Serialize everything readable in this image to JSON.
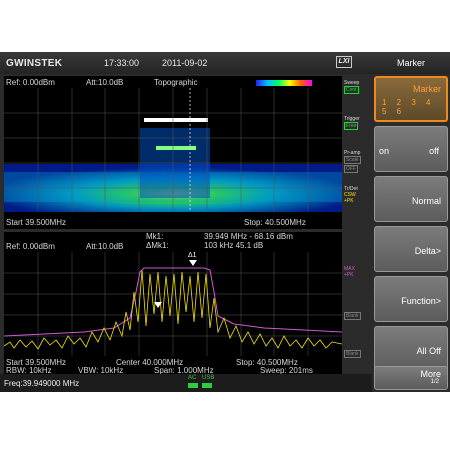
{
  "header": {
    "brand": "GWINSTEK",
    "time": "17:33:00",
    "date": "2011-09-02",
    "lxi": "LXI",
    "menu_title": "Marker"
  },
  "waterfall": {
    "ref": "Ref: 0.00dBm",
    "att": "Att:10.0dB",
    "mode": "Topographic",
    "start": "Start 39.500MHz",
    "stop": "Stop: 40.500MHz"
  },
  "spectrum": {
    "ref": "Ref: 0.00dBm",
    "att": "Att:10.0dB",
    "mk1_label": "Mk1:",
    "mk1_value": "39.949 MHz  - 68.16 dBm",
    "dmk1_label": "ΔMk1:",
    "dmk1_value": "103 kHz  45.1    dB",
    "start": "Start 39.500MHz",
    "center": "Center 40.000MHz",
    "stop": "Stop: 40.500MHz",
    "rbw": "RBW: 10kHz",
    "vbw": "VBW: 10kHz",
    "span": "Span: 1.000MHz",
    "sweep": "Sweep: 201ms",
    "marker_label": "Δ1"
  },
  "status": {
    "sweep_label": "Sweep",
    "sweep_value": "Cont",
    "trigger_label": "Trigger",
    "trigger_value": "Free",
    "preamp_label": "Pr-amp",
    "preamp_value1": "Scale",
    "preamp_value2": "OFF",
    "trdet_label": "Tr/Det",
    "trace1": "CSW",
    "trace1_det": "+PK",
    "trace2": "MAX",
    "trace2_det": "+PK",
    "trace3": "Blank",
    "trace4": "Blank"
  },
  "softkeys": {
    "marker_title": "Marker",
    "marker_numbers": "1 2 3 4 5 6",
    "on_label": "on",
    "off_label": "off",
    "normal": "Normal",
    "delta": "Delta>",
    "function": "Function>",
    "alloff": "All Off",
    "more": "More",
    "more_page": "1/2"
  },
  "footer": {
    "freq": "Freq:39.949000 MHz",
    "ac": "AC",
    "usb": "USB"
  },
  "colors": {
    "accent": "#f08a1c",
    "trace_yellow": "#f5e300",
    "trace_magenta": "#d05ad0",
    "status_green": "#2ecc40"
  }
}
